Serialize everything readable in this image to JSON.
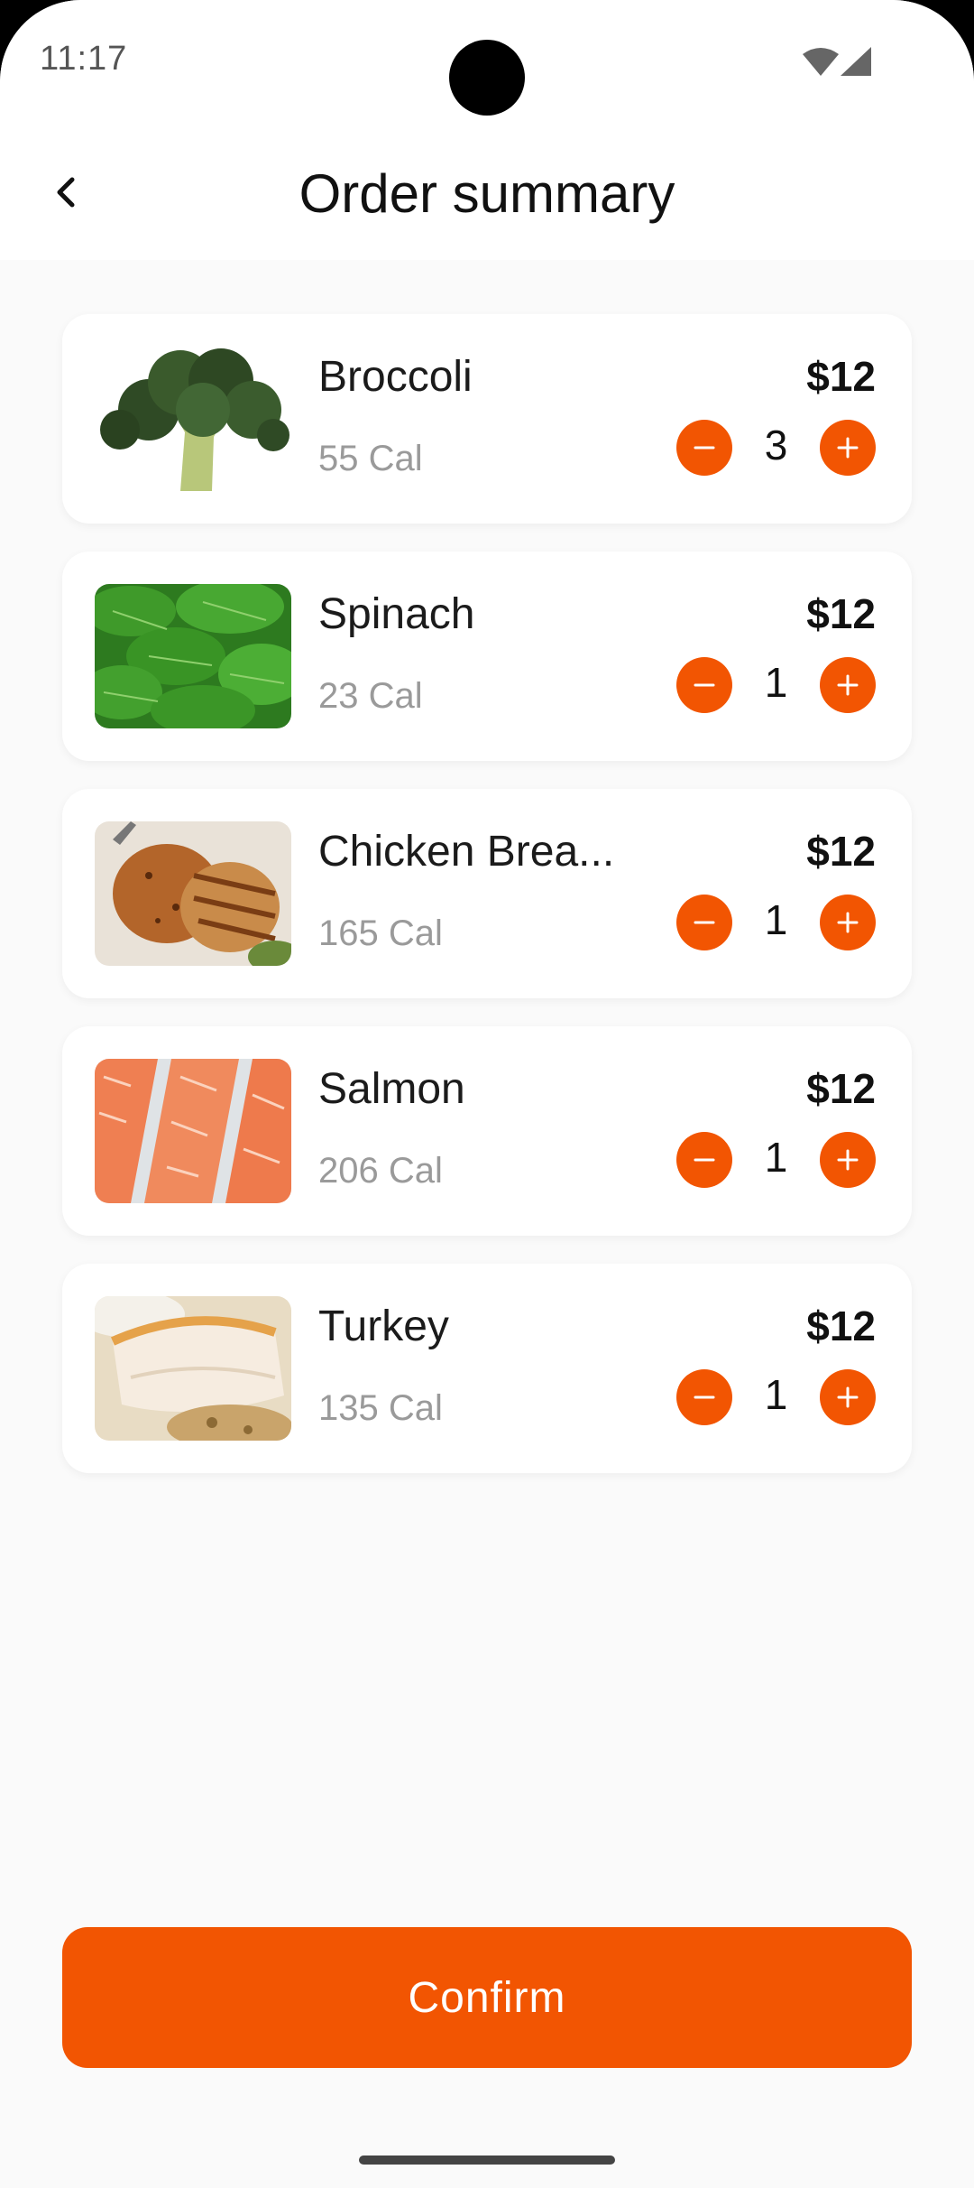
{
  "status": {
    "time": "11:17"
  },
  "header": {
    "title": "Order summary"
  },
  "items": [
    {
      "name": "Broccoli",
      "calories": "55 Cal",
      "price": "$12",
      "quantity": "3"
    },
    {
      "name": "Spinach",
      "calories": "23 Cal",
      "price": "$12",
      "quantity": "1"
    },
    {
      "name": "Chicken Brea...",
      "calories": "165 Cal",
      "price": "$12",
      "quantity": "1"
    },
    {
      "name": "Salmon",
      "calories": "206 Cal",
      "price": "$12",
      "quantity": "1"
    },
    {
      "name": "Turkey",
      "calories": "135 Cal",
      "price": "$12",
      "quantity": "1"
    }
  ],
  "footer": {
    "confirm_label": "Confirm"
  },
  "colors": {
    "accent": "#f25502",
    "background": "#fafafa",
    "card": "#ffffff"
  },
  "icons": [
    "back-arrow-icon",
    "wifi-icon",
    "signal-icon",
    "minus-icon",
    "plus-icon"
  ]
}
